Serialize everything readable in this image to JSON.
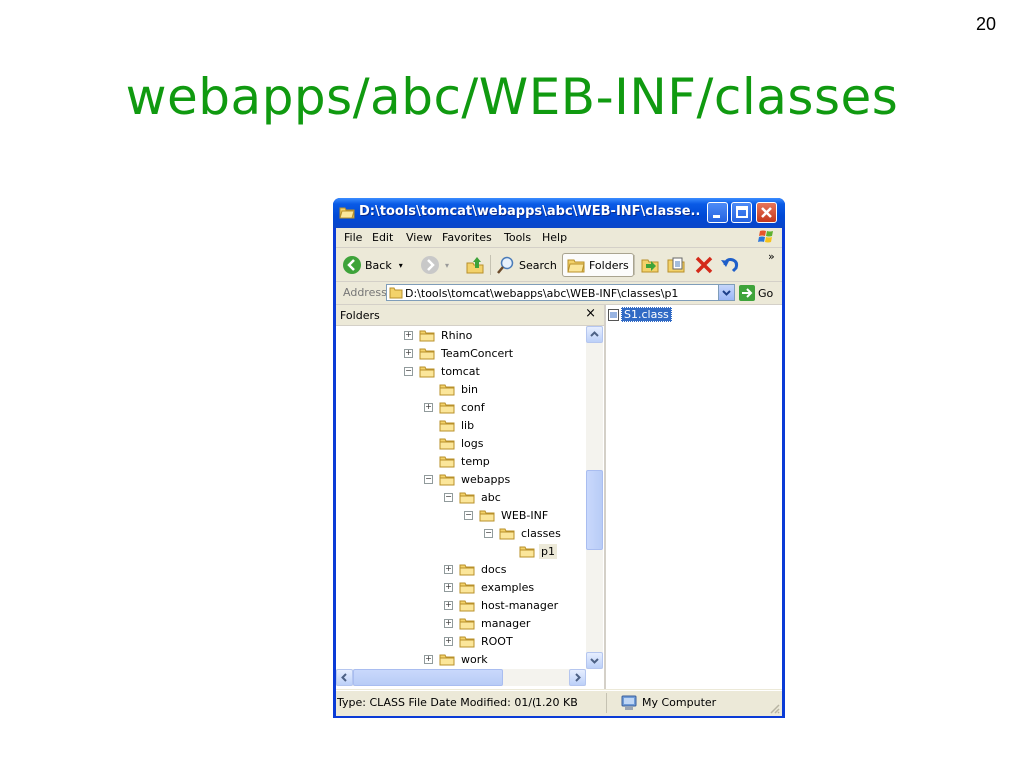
{
  "slide": {
    "page_number": "20",
    "title": "webapps/abc/WEB-INF/classes"
  },
  "window": {
    "title": "D:\\tools\\tomcat\\webapps\\abc\\WEB-INF\\classe...",
    "menu": [
      "File",
      "Edit",
      "View",
      "Favorites",
      "Tools",
      "Help"
    ],
    "toolbar": {
      "back_label": "Back",
      "search_label": "Search",
      "folders_label": "Folders"
    },
    "address": {
      "label": "Address",
      "value": "D:\\tools\\tomcat\\webapps\\abc\\WEB-INF\\classes\\p1",
      "go_label": "Go"
    },
    "folders_pane": {
      "header": "Folders",
      "close_glyph": "×",
      "tree": [
        {
          "label": "Rhino",
          "toggle": "+"
        },
        {
          "label": "TeamConcert",
          "toggle": "+"
        },
        {
          "label": "tomcat",
          "toggle": "−"
        },
        {
          "label": "bin",
          "toggle": ""
        },
        {
          "label": "conf",
          "toggle": "+"
        },
        {
          "label": "lib",
          "toggle": ""
        },
        {
          "label": "logs",
          "toggle": ""
        },
        {
          "label": "temp",
          "toggle": ""
        },
        {
          "label": "webapps",
          "toggle": "−"
        },
        {
          "label": "abc",
          "toggle": "−"
        },
        {
          "label": "WEB-INF",
          "toggle": "−"
        },
        {
          "label": "classes",
          "toggle": "−"
        },
        {
          "label": "p1",
          "toggle": "",
          "selected": true
        },
        {
          "label": "docs",
          "toggle": "+"
        },
        {
          "label": "examples",
          "toggle": "+"
        },
        {
          "label": "host-manager",
          "toggle": "+"
        },
        {
          "label": "manager",
          "toggle": "+"
        },
        {
          "label": "ROOT",
          "toggle": "+"
        },
        {
          "label": "work",
          "toggle": "+"
        }
      ]
    },
    "files": [
      {
        "name": "S1.class",
        "selected": true
      }
    ],
    "status": {
      "type_info": "Type: CLASS File Date Modified: 01/(",
      "size": "1.20 KB",
      "location": "My Computer"
    }
  },
  "colors": {
    "title_green": "#109a10",
    "xp_blue": "#0a5be6",
    "selection": "#316ac5",
    "folder_yellow": "#f3d26a"
  }
}
